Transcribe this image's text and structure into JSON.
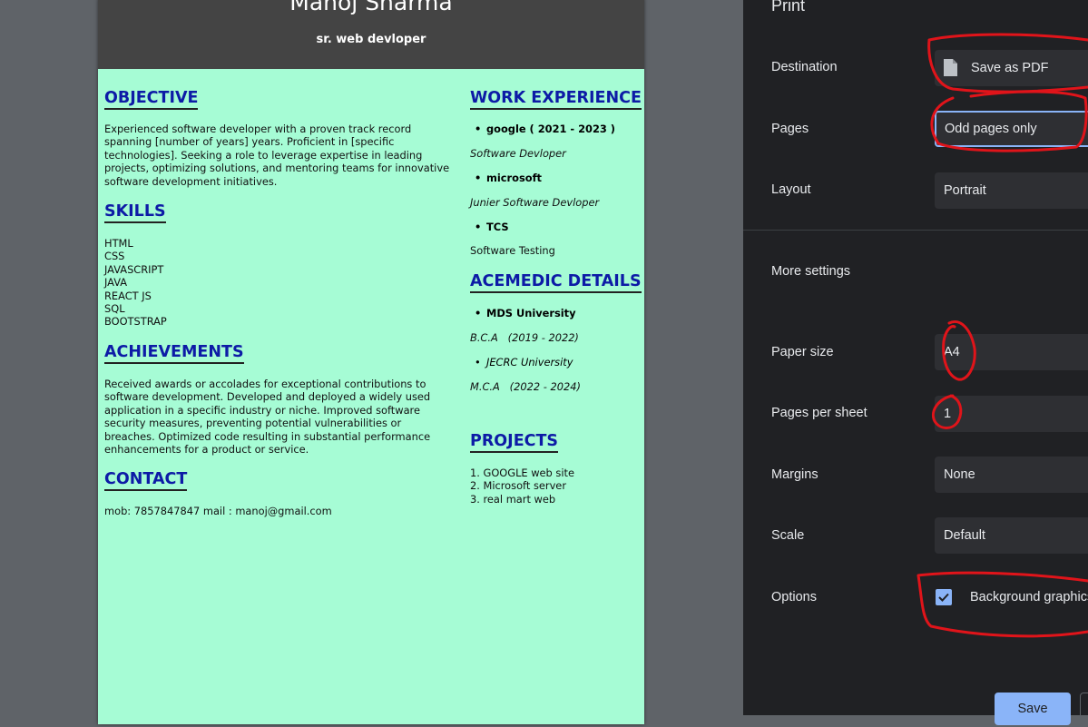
{
  "resume": {
    "name": "Manoj Sharma",
    "title": "sr. web devloper",
    "objective": {
      "heading": "OBJECTIVE",
      "lines": [
        "Experienced software developer with a proven track record",
        "spanning [number of years] years. Proficient in [specific",
        "technologies]. Seeking a role to leverage expertise in leading",
        "projects, optimizing solutions, and mentoring teams for innovative",
        "software development initiatives."
      ]
    },
    "skills": {
      "heading": "SKILLS",
      "items": [
        "HTML",
        "CSS",
        "JAVASCRIPT",
        "JAVA",
        "REACT JS",
        "SQL",
        "BOOTSTRAP"
      ]
    },
    "achievements": {
      "heading": "ACHIEVEMENTS",
      "lines": [
        "Received awards or accolades for exceptional contributions to",
        "software development. Developed and deployed a widely used",
        "application in a specific industry or niche. Improved software",
        "security measures, preventing potential vulnerabilities or",
        "breaches. Optimized code resulting in substantial performance",
        "enhancements for a product or service."
      ]
    },
    "contact": {
      "heading": "CONTACT",
      "text": "mob: 7857847847 mail : manoj@gmail.com"
    },
    "work": {
      "heading": "WORK EXPERIENCE",
      "entries": [
        {
          "company": "google ( 2021 - 2023 )",
          "role": "Software Devloper"
        },
        {
          "company": "microsoft",
          "role": "Junier Software Devloper"
        },
        {
          "company": "TCS",
          "role": "Software Testing"
        }
      ]
    },
    "academic": {
      "heading": "ACEMEDIC DETAILS",
      "entries": [
        {
          "school": "MDS University",
          "degree": "B.C.A   (2019 - 2022)"
        },
        {
          "school": "JECRC University",
          "degree": "M.C.A   (2022 - 2024)"
        }
      ]
    },
    "projects": {
      "heading": "PROJECTS",
      "items": [
        "1. GOOGLE web site",
        "2. Microsoft server",
        "3. real mart web"
      ]
    }
  },
  "print_panel": {
    "title": "Print",
    "destination": {
      "label": "Destination",
      "value": "Save as PDF"
    },
    "pages": {
      "label": "Pages",
      "value": "Odd pages only"
    },
    "layout": {
      "label": "Layout",
      "value": "Portrait"
    },
    "more_settings": "More settings",
    "paper_size": {
      "label": "Paper size",
      "value": "A4"
    },
    "pages_per_sheet": {
      "label": "Pages per sheet",
      "value": "1"
    },
    "margins": {
      "label": "Margins",
      "value": "None"
    },
    "scale": {
      "label": "Scale",
      "value": "Default"
    },
    "options": {
      "label": "Options",
      "checkbox_label": "Background graphics",
      "checked": true
    },
    "save_label": "Save"
  },
  "colors": {
    "paper_bg": "#a6fcd5",
    "heading": "#0d1ba6",
    "panel_bg": "#202124",
    "accent": "#8ab4f8",
    "annotation": "#e0141a"
  }
}
